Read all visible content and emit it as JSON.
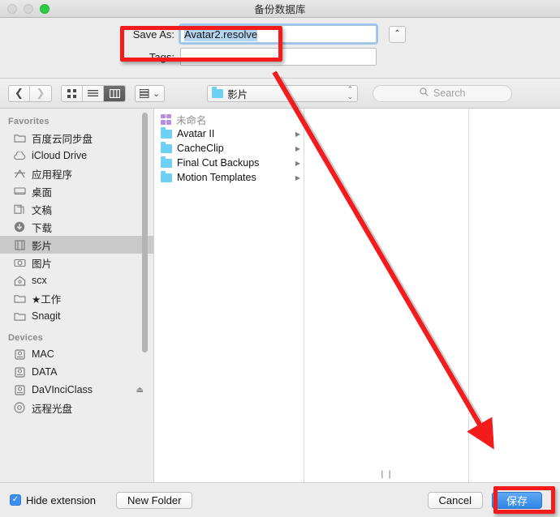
{
  "window": {
    "title": "备份数据库",
    "traffic_lights": [
      "close-disabled",
      "minimize-disabled",
      "zoom-green"
    ]
  },
  "save_header": {
    "save_as_label": "Save As:",
    "save_as_value": "Avatar2.resolve",
    "tags_label": "Tags:",
    "tags_value": "",
    "collapse_button_glyph": "⌃"
  },
  "toolbar": {
    "back_glyph": "❮",
    "forward_glyph": "❯",
    "view_icon_glyph": "⠿",
    "view_list_glyph": "☰",
    "view_column_glyph": "▥",
    "arrange_glyph": "▤",
    "arrange_caret": "⌄",
    "path_label": "影片",
    "path_stepper": "⌃\n⌄",
    "search_placeholder": "Search",
    "search_icon_glyph": "⌕"
  },
  "sidebar": {
    "sections": [
      {
        "header": "Favorites",
        "items": [
          {
            "label": "百度云同步盘",
            "icon": "folder-icon",
            "glyph": "🗀",
            "selected": false,
            "eject": false
          },
          {
            "label": "iCloud Drive",
            "icon": "cloud-icon",
            "glyph": "☁",
            "selected": false,
            "eject": false
          },
          {
            "label": "应用程序",
            "icon": "applications-icon",
            "glyph": "⌂",
            "selected": false,
            "eject": false
          },
          {
            "label": "桌面",
            "icon": "desktop-icon",
            "glyph": "▤",
            "selected": false,
            "eject": false
          },
          {
            "label": "文稿",
            "icon": "documents-icon",
            "glyph": "🗎",
            "selected": false,
            "eject": false
          },
          {
            "label": "下载",
            "icon": "downloads-icon",
            "glyph": "⬇",
            "selected": false,
            "eject": false
          },
          {
            "label": "影片",
            "icon": "movies-icon",
            "glyph": "🎞",
            "selected": true,
            "eject": false
          },
          {
            "label": "图片",
            "icon": "pictures-icon",
            "glyph": "🖻",
            "selected": false,
            "eject": false
          },
          {
            "label": "scx",
            "icon": "home-icon",
            "glyph": "⌂",
            "selected": false,
            "eject": false
          },
          {
            "label": "★工作",
            "icon": "folder-icon",
            "glyph": "🗀",
            "selected": false,
            "eject": false
          },
          {
            "label": "Snagit",
            "icon": "folder-icon",
            "glyph": "🗀",
            "selected": false,
            "eject": false
          }
        ]
      },
      {
        "header": "Devices",
        "items": [
          {
            "label": "MAC",
            "icon": "harddisk-icon",
            "glyph": "▤",
            "selected": false,
            "eject": false
          },
          {
            "label": "DATA",
            "icon": "harddisk-icon",
            "glyph": "▤",
            "selected": false,
            "eject": false
          },
          {
            "label": "DaVInciClass",
            "icon": "harddisk-icon",
            "glyph": "▤",
            "selected": false,
            "eject": true
          },
          {
            "label": "远程光盘",
            "icon": "optical-disc-icon",
            "glyph": "◎",
            "selected": false,
            "eject": false
          }
        ]
      }
    ],
    "eject_glyph": "⏏"
  },
  "browser": {
    "column1": [
      {
        "name": "未命名",
        "icon": "grid-icon",
        "dim": true,
        "has_arrow": false
      },
      {
        "name": "Avatar II",
        "icon": "folder-icon",
        "dim": false,
        "has_arrow": true
      },
      {
        "name": "CacheClip",
        "icon": "folder-icon",
        "dim": false,
        "has_arrow": true
      },
      {
        "name": "Final Cut Backups",
        "icon": "folder-icon",
        "dim": false,
        "has_arrow": true
      },
      {
        "name": "Motion Templates",
        "icon": "folder-icon",
        "dim": false,
        "has_arrow": true
      }
    ],
    "column2": [],
    "column3": [],
    "disclosure_arrow_glyph": "▶",
    "column_grip_glyph": "❙❙"
  },
  "bottom_bar": {
    "hide_extension_label": "Hide extension",
    "hide_extension_checked": true,
    "check_glyph": "✓",
    "new_folder_label": "New Folder",
    "cancel_label": "Cancel",
    "save_label": "保存"
  },
  "annotations": {
    "highlight_color": "#f31b1b",
    "boxes": [
      "save-as-field",
      "save-button"
    ],
    "arrow": {
      "from": "save-as-field",
      "to": "save-button"
    }
  }
}
